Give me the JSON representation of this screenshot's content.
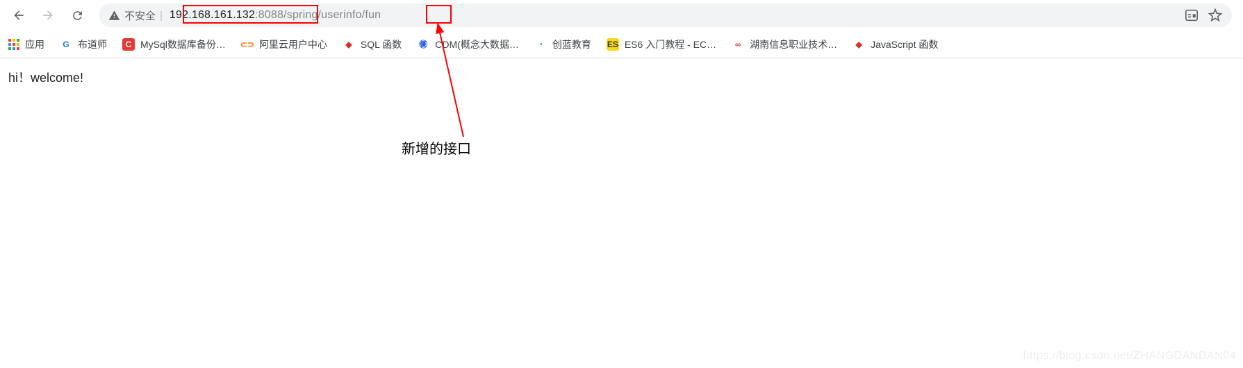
{
  "nav": {
    "insecure_label": "不安全",
    "url_host": "192.168.161.132",
    "url_port": ":8088",
    "url_path": "/spring/userinfo/fun"
  },
  "bookmarks": {
    "apps_label": "应用",
    "items": [
      {
        "label": "布道师",
        "bg": "#ffffff",
        "fg": "#1a73e8",
        "glyph": "G"
      },
      {
        "label": "MySql数据库备份…",
        "bg": "#e53935",
        "fg": "#ffffff",
        "glyph": "C"
      },
      {
        "label": "阿里云用户中心",
        "bg": "#ffffff",
        "fg": "#ff6a00",
        "glyph": "⊂⊃"
      },
      {
        "label": "SQL 函数",
        "bg": "#ffffff",
        "fg": "#d93025",
        "glyph": "◆"
      },
      {
        "label": "CDM(概念大数据…",
        "bg": "#ffffff",
        "fg": "#2b60de",
        "glyph": "㊝"
      },
      {
        "label": "创蓝教育",
        "bg": "#ffffff",
        "fg": "#1a73e8",
        "glyph": "◔"
      },
      {
        "label": "ES6 入门教程 - EC…",
        "bg": "#f9d71c",
        "fg": "#333333",
        "glyph": "ES"
      },
      {
        "label": "湖南信息职业技术…",
        "bg": "#ffffff",
        "fg": "#e53935",
        "glyph": "∞"
      },
      {
        "label": "JavaScript 函数",
        "bg": "#ffffff",
        "fg": "#d93025",
        "glyph": "◆"
      }
    ]
  },
  "page": {
    "body_text": "hi！welcome!"
  },
  "annotation": {
    "text": "新增的接口"
  },
  "watermark": {
    "text": "https://blog.csdn.net/ZHANGDANDAN04"
  },
  "apps_icon_colors": [
    "#ea4335",
    "#fbbc05",
    "#34a853",
    "#4285f4",
    "#ea4335",
    "#fbbc05",
    "#34a853",
    "#4285f4",
    "#ea4335"
  ]
}
